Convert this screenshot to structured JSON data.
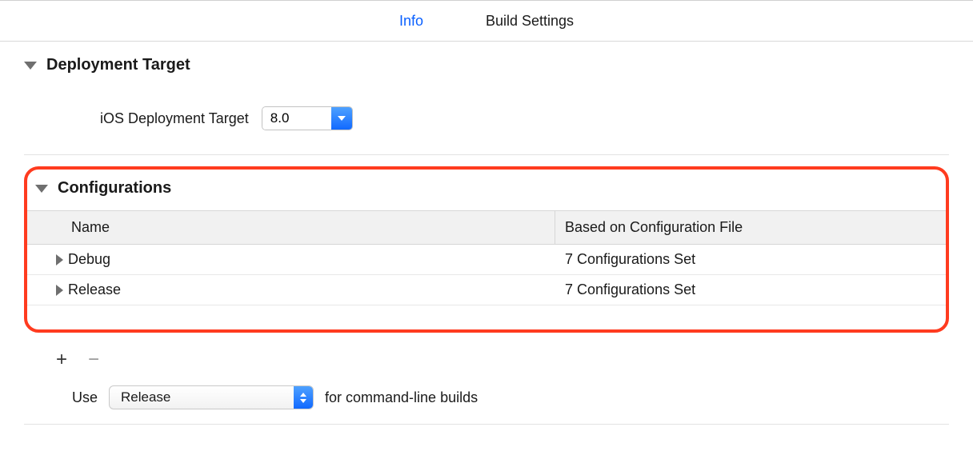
{
  "tabs": {
    "info": "Info",
    "build_settings": "Build Settings"
  },
  "deployment": {
    "section_title": "Deployment Target",
    "label": "iOS Deployment Target",
    "value": "8.0"
  },
  "configurations": {
    "section_title": "Configurations",
    "columns": {
      "name": "Name",
      "file": "Based on Configuration File"
    },
    "rows": [
      {
        "name": "Debug",
        "file": "7 Configurations Set"
      },
      {
        "name": "Release",
        "file": "7 Configurations Set"
      }
    ]
  },
  "use_row": {
    "prefix": "Use",
    "value": "Release",
    "suffix": "for command-line builds"
  },
  "glyphs": {
    "plus": "+",
    "minus": "−"
  }
}
